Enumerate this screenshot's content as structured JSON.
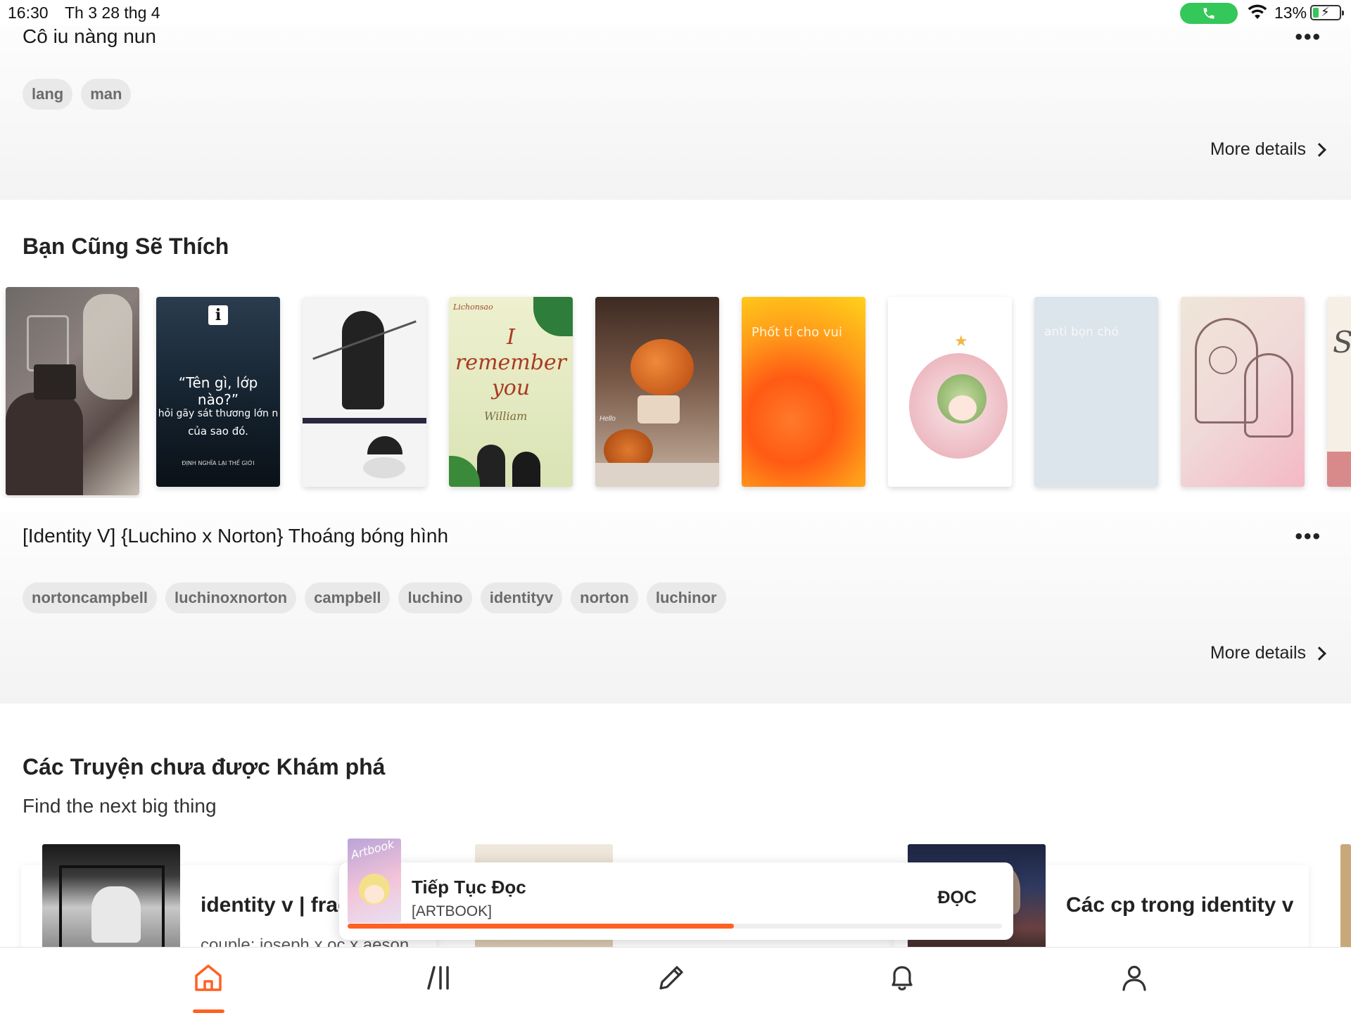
{
  "status_bar": {
    "time": "16:30",
    "date": "Th 3 28 thg 4",
    "battery": "13%",
    "call_color": "#34c759"
  },
  "top_story": {
    "title": "Cô iu nàng nun",
    "menu": "•••",
    "tags": [
      "lang",
      "man"
    ],
    "more_details": "More details"
  },
  "recommend": {
    "heading": "Bạn Cũng Sẽ Thích",
    "covers": [
      {
        "name": "cover-1",
        "text": ""
      },
      {
        "name": "cover-2",
        "quote": "“Tên gì, lớp nào?”",
        "line1": "hỏi gãy sát thương lớn n",
        "line2": "của sao đó.",
        "credit": "ĐỊNH NGHĨA LẠI THẾ GIỚI"
      },
      {
        "name": "cover-3",
        "text": ""
      },
      {
        "name": "cover-4",
        "brand": "Lichonsao",
        "title": "I remember you",
        "author": "William"
      },
      {
        "name": "cover-5",
        "text": "Hello"
      },
      {
        "name": "cover-6",
        "text": "Phốt tí cho vui"
      },
      {
        "name": "cover-7",
        "text": ""
      },
      {
        "name": "cover-8",
        "text": "anti bọn chó"
      },
      {
        "name": "cover-9",
        "text": ""
      },
      {
        "name": "cover-10",
        "text": "Sc"
      }
    ],
    "selected": {
      "title": "[Identity V] {Luchino x Norton} Thoáng bóng hình",
      "menu": "•••",
      "tags": [
        "nortoncampbell",
        "luchinoxnorton",
        "campbell",
        "luchino",
        "identityv",
        "norton",
        "luchinor"
      ],
      "more_details": "More details"
    }
  },
  "undiscovered": {
    "heading": "Các Truyện chưa được Khám phá",
    "subheading": "Find the next big thing",
    "cards": [
      {
        "title": "identity v | frag",
        "desc": "couple: joseph x oc x aeson"
      },
      {
        "title": "Các cp trong identity v",
        "desc": ""
      }
    ]
  },
  "continue_reading": {
    "title": "Tiếp Tục Đọc",
    "story": "[ARTBOOK]",
    "thumb_text": "Artbook",
    "button": "ĐỌC",
    "progress": 0.59,
    "accent": "#ff6122"
  },
  "bottom_nav": {
    "items": [
      "home-icon",
      "library-icon",
      "write-icon",
      "notifications-icon",
      "profile-icon"
    ],
    "active": "home-icon"
  }
}
